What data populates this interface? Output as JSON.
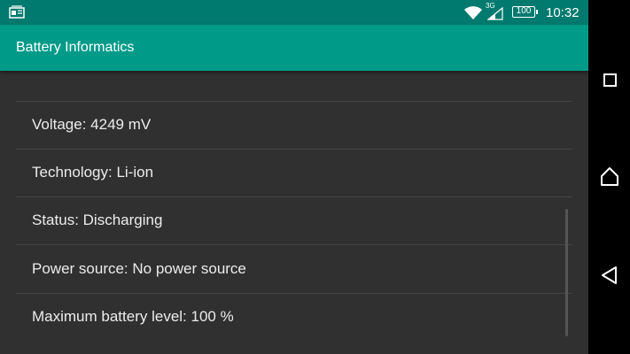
{
  "status_bar": {
    "time": "10:32",
    "battery_level": "100",
    "network_type": "3G",
    "notification_icon": "rss-news-icon",
    "wifi_icon": "wifi-icon",
    "signal_icon": "cell-signal-icon"
  },
  "app_bar": {
    "title": "Battery Informatics"
  },
  "info_list": [
    {
      "text": "Voltage: 4249 mV"
    },
    {
      "text": "Technology: Li-ion"
    },
    {
      "text": "Status: Discharging"
    },
    {
      "text": "Power source: No power source"
    },
    {
      "text": "Maximum battery level: 100 %"
    }
  ],
  "nav_bar": {
    "recents_icon": "square-icon",
    "home_icon": "home-icon",
    "back_icon": "triangle-back-icon"
  },
  "colors": {
    "status_bar": "#007a6e",
    "app_bar": "#009a88",
    "background": "#303030",
    "divider": "#444444",
    "text": "#ececec"
  }
}
